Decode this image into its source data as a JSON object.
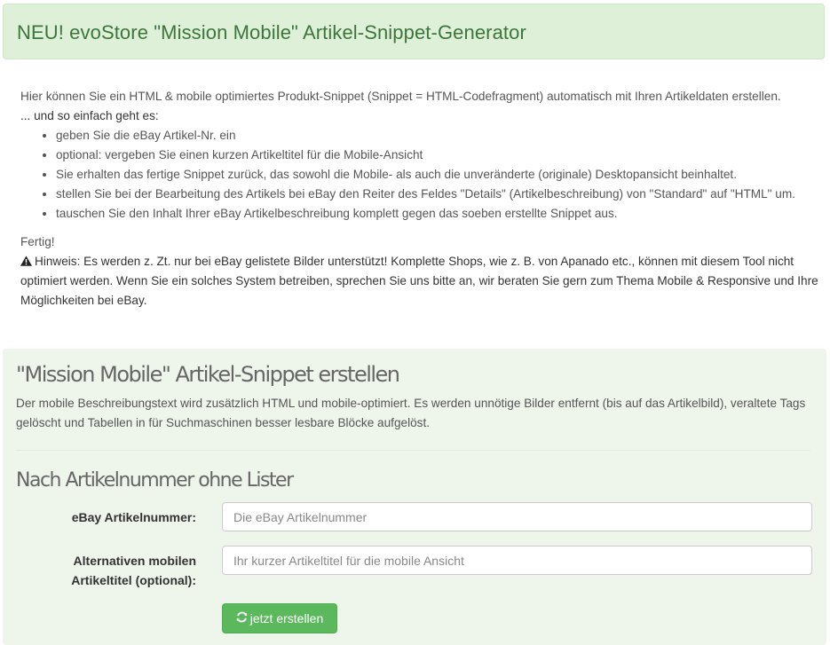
{
  "header": {
    "title": "NEU! evoStore \"Mission Mobile\" Artikel-Snippet-Generator"
  },
  "intro": {
    "paragraph": "Hier können Sie ein HTML & mobile optimiertes Produkt-Snippet (Snippet = HTML-Codefragment) automatisch mit Ihren Artikeldaten erstellen.",
    "lead": "... und so einfach geht es:",
    "steps": [
      "geben Sie die eBay Artikel-Nr. ein",
      "optional: vergeben Sie einen kurzen Artikeltitel für die Mobile-Ansicht",
      "Sie erhalten das fertige Snippet zurück, das sowohl die Mobile- als auch die unveränderte (originale) Desktopansicht beinhaltet.",
      "stellen Sie bei der Bearbeitung des Artikels bei eBay den Reiter des Feldes \"Details\" (Artikelbeschreibung) von \"Standard\" auf \"HTML\" um.",
      "tauschen Sie den Inhalt Ihrer eBay Artikelbeschreibung komplett gegen das soeben erstellte Snippet aus."
    ],
    "done": "Fertig!",
    "hint": "Hinweis: Es werden z. Zt. nur bei eBay gelistete Bilder unterstützt! Komplette Shops, wie z. B. von Apanado etc., können mit diesem Tool nicht optimiert werden. Wenn Sie ein solches System betreiben, sprechen Sie uns bitte an, wir beraten Sie gern zum Thema Mobile & Responsive und Ihre Möglichkeiten bei eBay."
  },
  "panel": {
    "title": "\"Mission Mobile\" Artikel-Snippet erstellen",
    "description": "Der mobile Beschreibungstext wird zusätzlich HTML und mobile-optimiert. Es werden unnötige Bilder entfernt (bis auf das Artikelbild), veraltete Tags gelöscht und Tabellen in für Suchmaschinen besser lesbare Blöcke aufgelöst.",
    "subtitle": "Nach Artikelnummer ohne Lister",
    "form": {
      "item_number_label": "eBay Artikelnummer:",
      "item_number_placeholder": "Die eBay Artikelnummer",
      "item_number_value": "",
      "alt_title_label": "Alternativen mobilen Artikeltitel (optional):",
      "alt_title_placeholder": "Ihr kurzer Artikeltitel für die mobile Ansicht",
      "alt_title_value": "",
      "submit_label": "jetzt erstellen",
      "submit_icon": "refresh-icon"
    }
  },
  "colors": {
    "alert_bg": "#dff0d8",
    "alert_text": "#3c763d",
    "panel_bg": "#eef5eb",
    "button_bg": "#5cb85c"
  },
  "icons": {
    "hint": "warning-icon"
  }
}
